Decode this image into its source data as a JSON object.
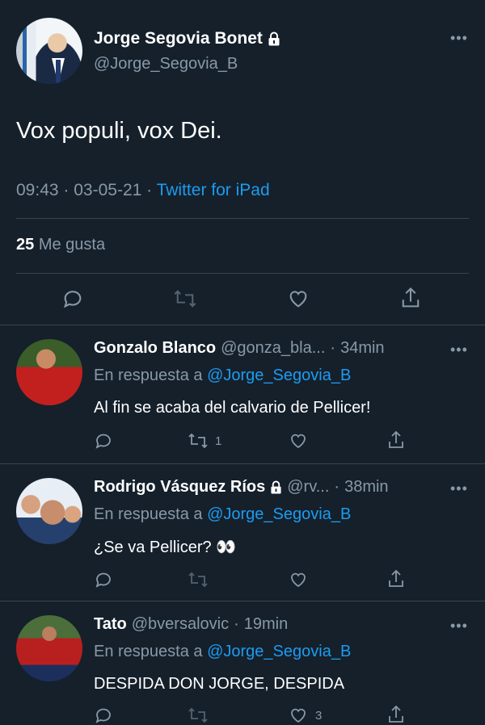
{
  "main_tweet": {
    "author_name": "Jorge Segovia Bonet",
    "author_handle": "@Jorge_Segovia_B",
    "text": "Vox populi, vox Dei.",
    "time": "09:43",
    "date": "03-05-21",
    "source": "Twitter for iPad",
    "likes_count": "25",
    "likes_label": "Me gusta",
    "more_icon": "more-icon"
  },
  "replies": [
    {
      "name": "Gonzalo Blanco",
      "handle": "@gonza_bla...",
      "time": "34min",
      "reply_prefix": "En respuesta a",
      "reply_to": "@Jorge_Segovia_B",
      "text": "Al fin se acaba del calvario de Pellicer!",
      "retweets": "1",
      "likes": ""
    },
    {
      "name": "Rodrigo Vásquez Ríos",
      "handle": "@rv...",
      "time": "38min",
      "reply_prefix": "En respuesta a",
      "reply_to": "@Jorge_Segovia_B",
      "text": "¿Se va Pellicer?",
      "emoji": "👀",
      "retweets": "",
      "likes": ""
    },
    {
      "name": "Tato",
      "handle": "@bversalovic",
      "time": "19min",
      "reply_prefix": "En respuesta a",
      "reply_to": "@Jorge_Segovia_B",
      "text": "DESPIDA DON JORGE, DESPIDA",
      "retweets": "",
      "likes": "3"
    }
  ],
  "colors": {
    "background": "#15202b",
    "link": "#1d9bf0",
    "muted": "#8899a6",
    "divider": "#38444d"
  }
}
